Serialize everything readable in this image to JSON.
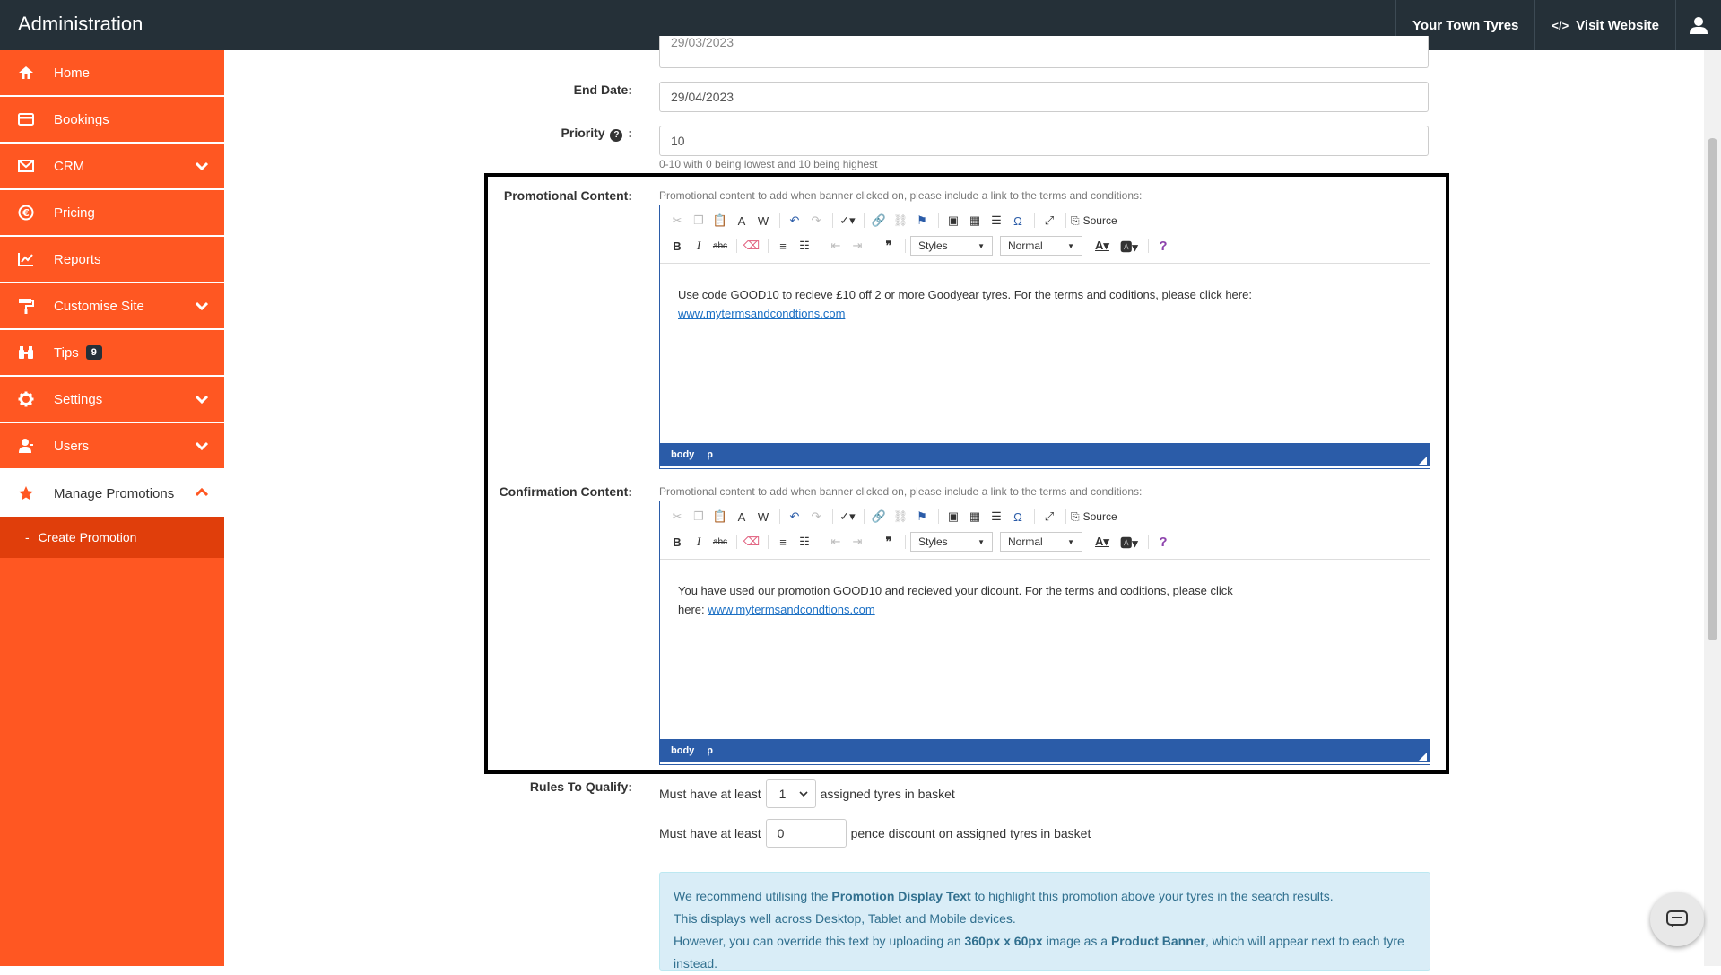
{
  "topbar": {
    "title": "Administration",
    "site_name": "Your Town Tyres",
    "visit_website": "Visit Website"
  },
  "sidebar": {
    "items": [
      {
        "label": "Home",
        "icon": "home-icon"
      },
      {
        "label": "Bookings",
        "icon": "credit-card-icon"
      },
      {
        "label": "CRM",
        "icon": "envelope-icon"
      },
      {
        "label": "Pricing",
        "icon": "euro-icon"
      },
      {
        "label": "Reports",
        "icon": "line-chart-icon"
      },
      {
        "label": "Customise Site",
        "icon": "paint-roller-icon"
      },
      {
        "label": "Tips",
        "icon": "binoculars-icon",
        "badge": "9"
      },
      {
        "label": "Settings",
        "icon": "gear-icon"
      },
      {
        "label": "Users",
        "icon": "user-icon"
      },
      {
        "label": "Manage Promotions",
        "icon": "star-icon"
      }
    ],
    "sub_item": "Create Promotion"
  },
  "form": {
    "start_date_value": "29/03/2023",
    "end_date_label": "End Date:",
    "end_date_value": "29/04/2023",
    "priority_label": "Priority",
    "priority_suffix": ":",
    "priority_value": "10",
    "priority_hint": "0-10 with 0 being lowest and 10 being highest",
    "promo_label": "Promotional Content:",
    "promo_hint": "Promotional content to add when banner clicked on, please include a link to the terms and conditions:",
    "promo_text": "Use code GOOD10 to recieve £10 off 2 or more Goodyear tyres. For the terms and coditions, please click here:",
    "promo_link": "www.mytermsandcondtions.com",
    "confirm_label": "Confirmation Content:",
    "confirm_hint": "Promotional content to add when banner clicked on, please include a link to the terms and conditions:",
    "confirm_text": "You have used our promotion GOOD10 and recieved your dicount. For the terms and coditions, please click here:",
    "confirm_link": "www.mytermsandcondtions.com",
    "rules_label": "Rules To Qualify:",
    "rule1_prefix": "Must have at least",
    "rule1_value": "1",
    "rule1_suffix": "assigned tyres in basket",
    "rule2_prefix": "Must have at least",
    "rule2_value": "0",
    "rule2_suffix": "pence discount on assigned tyres in basket"
  },
  "editor": {
    "source": "Source",
    "styles": "Styles",
    "format": "Normal",
    "path_body": "body",
    "path_p": "p"
  },
  "info": {
    "line1_a": "We recommend utilising the ",
    "line1_b": "Promotion Display Text",
    "line1_c": " to highlight this promotion above your tyres in the search results.",
    "line2": "This displays well across Desktop, Tablet and Mobile devices.",
    "line3_a": "However, you can override this text by uploading an ",
    "line3_b": "360px x 60px",
    "line3_c": " image as a ",
    "line3_d": "Product Banner",
    "line3_e": ", which will appear next to each tyre instead."
  },
  "colors": {
    "sidebar": "#ff5722",
    "sidebar_sub": "#e03e0b",
    "topbar": "#253038",
    "editor_chrome": "#2b5ca8",
    "info_bg": "#d9edf7"
  }
}
